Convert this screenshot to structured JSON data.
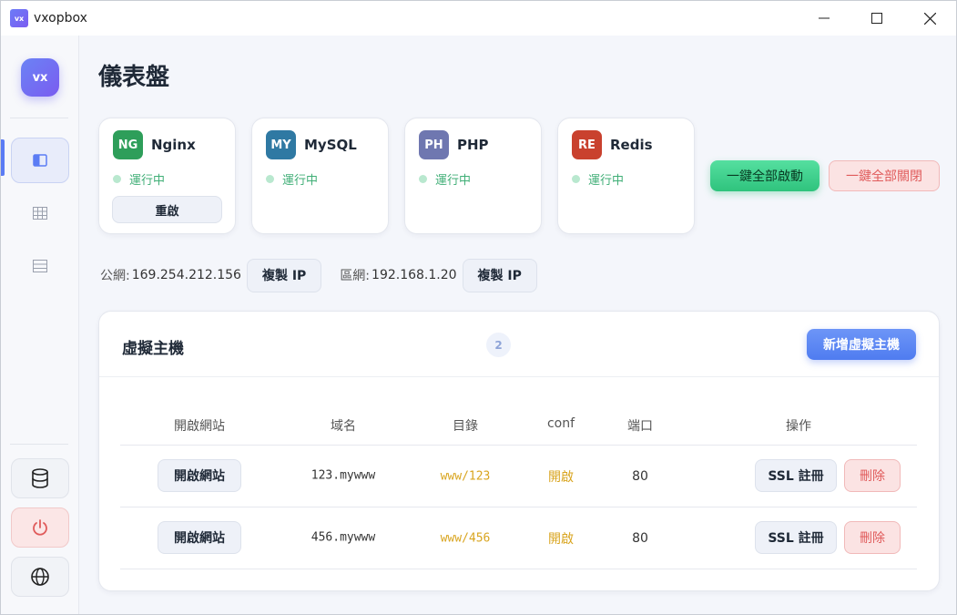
{
  "window": {
    "title": "vxopbox",
    "logo_text": "vx"
  },
  "sidebar": {
    "logo_text": "vx",
    "items": [
      {
        "icon": "panel-icon",
        "active": true
      },
      {
        "icon": "grid-icon",
        "active": false
      },
      {
        "icon": "list-icon",
        "active": false
      }
    ],
    "bottom": [
      {
        "icon": "database-icon"
      },
      {
        "icon": "power-icon"
      },
      {
        "icon": "globe-icon"
      }
    ]
  },
  "page": {
    "title": "儀表盤"
  },
  "services": [
    {
      "badge": "NG",
      "name": "Nginx",
      "status": "運行中",
      "color": "#2e9e5a",
      "restart_label": "重啟"
    },
    {
      "badge": "MY",
      "name": "MySQL",
      "status": "運行中",
      "color": "#2f79a3"
    },
    {
      "badge": "PH",
      "name": "PHP",
      "status": "運行中",
      "color": "#6f77b0"
    },
    {
      "badge": "RE",
      "name": "Redis",
      "status": "運行中",
      "color": "#c9412e"
    }
  ],
  "actions": {
    "start_all": "一鍵全部啟動",
    "stop_all": "一鍵全部關閉"
  },
  "network": {
    "public_label": "公網:",
    "public_ip": "169.254.212.156",
    "lan_label": "區網:",
    "lan_ip": "192.168.1.20",
    "copy_label": "複製 IP"
  },
  "vhosts": {
    "title": "虛擬主機",
    "count": "2",
    "add_label": "新增虛擬主機",
    "columns": [
      "開啟網站",
      "域名",
      "目錄",
      "conf",
      "端口",
      "操作"
    ],
    "rows": [
      {
        "open_label": "開啟網站",
        "domain": "123.mywww",
        "dir": "www/123",
        "conf": "開啟",
        "port": "80",
        "ssl_label": "SSL 註冊",
        "delete_label": "刪除"
      },
      {
        "open_label": "開啟網站",
        "domain": "456.mywww",
        "dir": "www/456",
        "conf": "開啟",
        "port": "80",
        "ssl_label": "SSL 註冊",
        "delete_label": "刪除"
      }
    ]
  },
  "colors": {
    "accent": "#5b7cf4",
    "success": "#2fc37d",
    "danger": "#e05b5b",
    "warning_text": "#d9a520"
  }
}
